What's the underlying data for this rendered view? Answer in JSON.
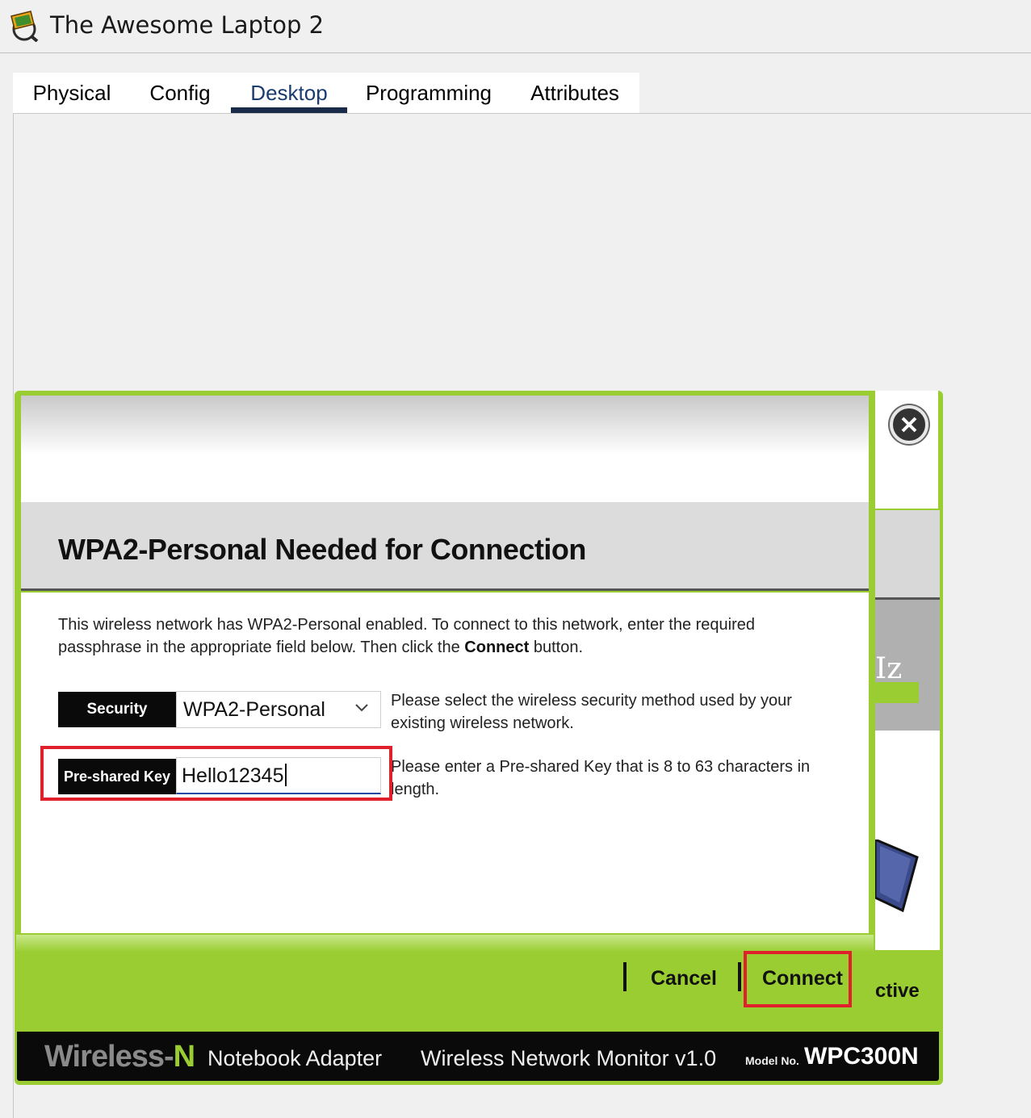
{
  "window": {
    "title": "The Awesome Laptop 2",
    "icon": "laptop-app-icon"
  },
  "tabs": [
    {
      "label": "Physical",
      "active": false
    },
    {
      "label": "Config",
      "active": false
    },
    {
      "label": "Desktop",
      "active": true
    },
    {
      "label": "Programming",
      "active": false
    },
    {
      "label": "Attributes",
      "active": false
    }
  ],
  "dialog": {
    "title": "WPA2-Personal Needed for Connection",
    "description_part1": "This wireless network has WPA2-Personal enabled. To connect to this network, enter the required passphrase in the appropriate field below. Then click the ",
    "description_bold": "Connect",
    "description_part2": " button.",
    "security_label": "Security",
    "security_value": "WPA2-Personal",
    "security_hint": "Please select the wireless security method used by your existing wireless network.",
    "key_label": "Pre-shared Key",
    "key_value": "Hello12345",
    "key_hint": "Please enter a Pre-shared Key that is 8 to 63 characters in length.",
    "cancel_label": "Cancel",
    "connect_label": "Connect"
  },
  "monitor": {
    "partial_text_hz": "Iz",
    "partial_text_active": "ctive",
    "brand_wireless": "Wireless-",
    "brand_n": "N",
    "brand_adapter": "Notebook Adapter",
    "brand_monitor": "Wireless Network Monitor  v1.0",
    "model_label": "Model No.",
    "model_value": "WPC300N"
  },
  "colors": {
    "accent_green": "#9acd32",
    "highlight_red": "#e0202a",
    "tab_active": "#1a2b4a"
  }
}
